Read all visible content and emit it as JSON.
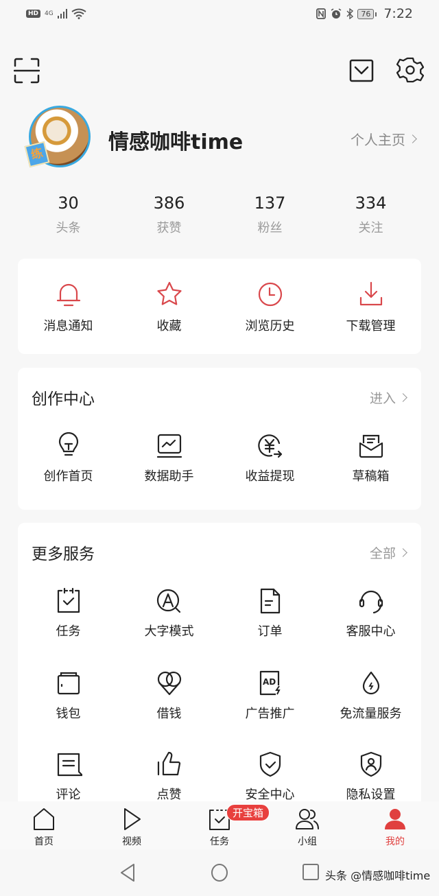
{
  "status_bar": {
    "left_badges": [
      "HD",
      "4G"
    ],
    "battery": "76",
    "time": "7:22"
  },
  "top_actions": {
    "scan_icon": "scan-icon",
    "mail_icon": "mail-icon",
    "settings_icon": "gear-icon"
  },
  "profile": {
    "username": "情感咖啡time",
    "avatar_badge": "练",
    "profile_link": "个人主页"
  },
  "stats": [
    {
      "value": "30",
      "label": "头条"
    },
    {
      "value": "386",
      "label": "获赞"
    },
    {
      "value": "137",
      "label": "粉丝"
    },
    {
      "value": "334",
      "label": "关注"
    }
  ],
  "quick_actions": [
    {
      "label": "消息通知",
      "icon": "bell-icon"
    },
    {
      "label": "收藏",
      "icon": "star-icon"
    },
    {
      "label": "浏览历史",
      "icon": "clock-icon"
    },
    {
      "label": "下载管理",
      "icon": "download-icon"
    }
  ],
  "creation_center": {
    "title": "创作中心",
    "link": "进入",
    "items": [
      {
        "label": "创作首页",
        "icon": "lightbulb-icon"
      },
      {
        "label": "数据助手",
        "icon": "chart-monitor-icon"
      },
      {
        "label": "收益提现",
        "icon": "yuan-withdraw-icon"
      },
      {
        "label": "草稿箱",
        "icon": "draft-box-icon"
      }
    ]
  },
  "more_services": {
    "title": "更多服务",
    "link": "全部",
    "items": [
      {
        "label": "任务",
        "icon": "task-calendar-icon"
      },
      {
        "label": "大字模式",
        "icon": "large-font-icon"
      },
      {
        "label": "订单",
        "icon": "order-document-icon"
      },
      {
        "label": "客服中心",
        "icon": "headset-icon"
      },
      {
        "label": "钱包",
        "icon": "wallet-icon"
      },
      {
        "label": "借钱",
        "icon": "loan-icon"
      },
      {
        "label": "广告推广",
        "icon": "ad-icon"
      },
      {
        "label": "免流量服务",
        "icon": "data-drop-icon"
      },
      {
        "label": "评论",
        "icon": "comment-icon"
      },
      {
        "label": "点赞",
        "icon": "thumbs-up-icon"
      },
      {
        "label": "安全中心",
        "icon": "shield-check-icon"
      },
      {
        "label": "隐私设置",
        "icon": "privacy-shield-icon"
      }
    ]
  },
  "tab_bar": {
    "tabs": [
      {
        "label": "首页",
        "icon": "home-icon",
        "active": false
      },
      {
        "label": "视频",
        "icon": "play-icon",
        "active": false
      },
      {
        "label": "任务",
        "icon": "task-icon",
        "active": false,
        "badge": "开宝箱"
      },
      {
        "label": "小组",
        "icon": "group-icon",
        "active": false
      },
      {
        "label": "我的",
        "icon": "user-icon",
        "active": true
      }
    ]
  },
  "watermark": "头条 @情感咖啡time",
  "colors": {
    "accent": "#e0403f",
    "icon_red": "#d9474b",
    "background": "#f7f7f7",
    "card": "#ffffff",
    "muted_text": "#9a9a9a"
  }
}
